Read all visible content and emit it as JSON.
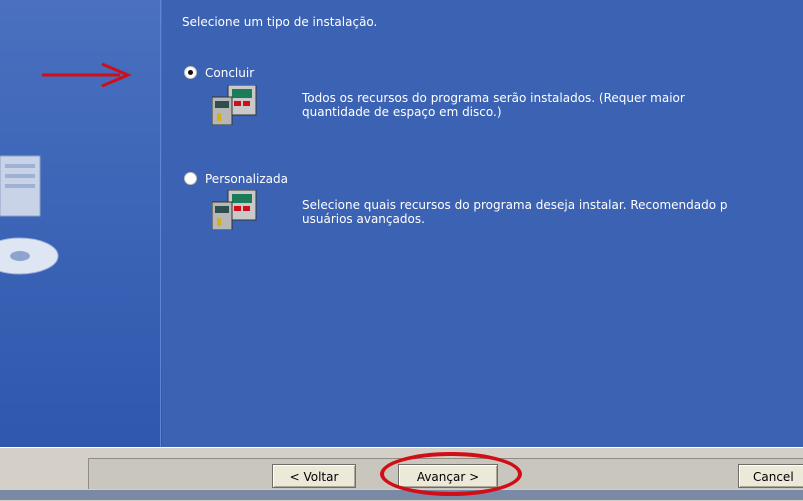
{
  "header": {
    "instruction": "Selecione um tipo de instalação."
  },
  "options": [
    {
      "label": "Concluir",
      "selected": true,
      "description_lines": [
        "Todos os recursos do programa serão instalados. (Requer maior",
        "quantidade de espaço em disco.)"
      ]
    },
    {
      "label": "Personalizada",
      "selected": false,
      "description_lines": [
        "Selecione quais recursos do programa deseja instalar. Recomendado p",
        "usuários avançados."
      ]
    }
  ],
  "buttons": {
    "back_label": "< Voltar",
    "next_label": "Avançar >",
    "cancel_label": "Cancel"
  },
  "colors": {
    "panel_blue": "#3b62b3",
    "annotation_red": "#d10d17",
    "button_face": "#ece9d8"
  },
  "icons": [
    "setup-package-icon",
    "computer-cd-decor",
    "red-arrow-annotation",
    "red-circle-annotation"
  ]
}
